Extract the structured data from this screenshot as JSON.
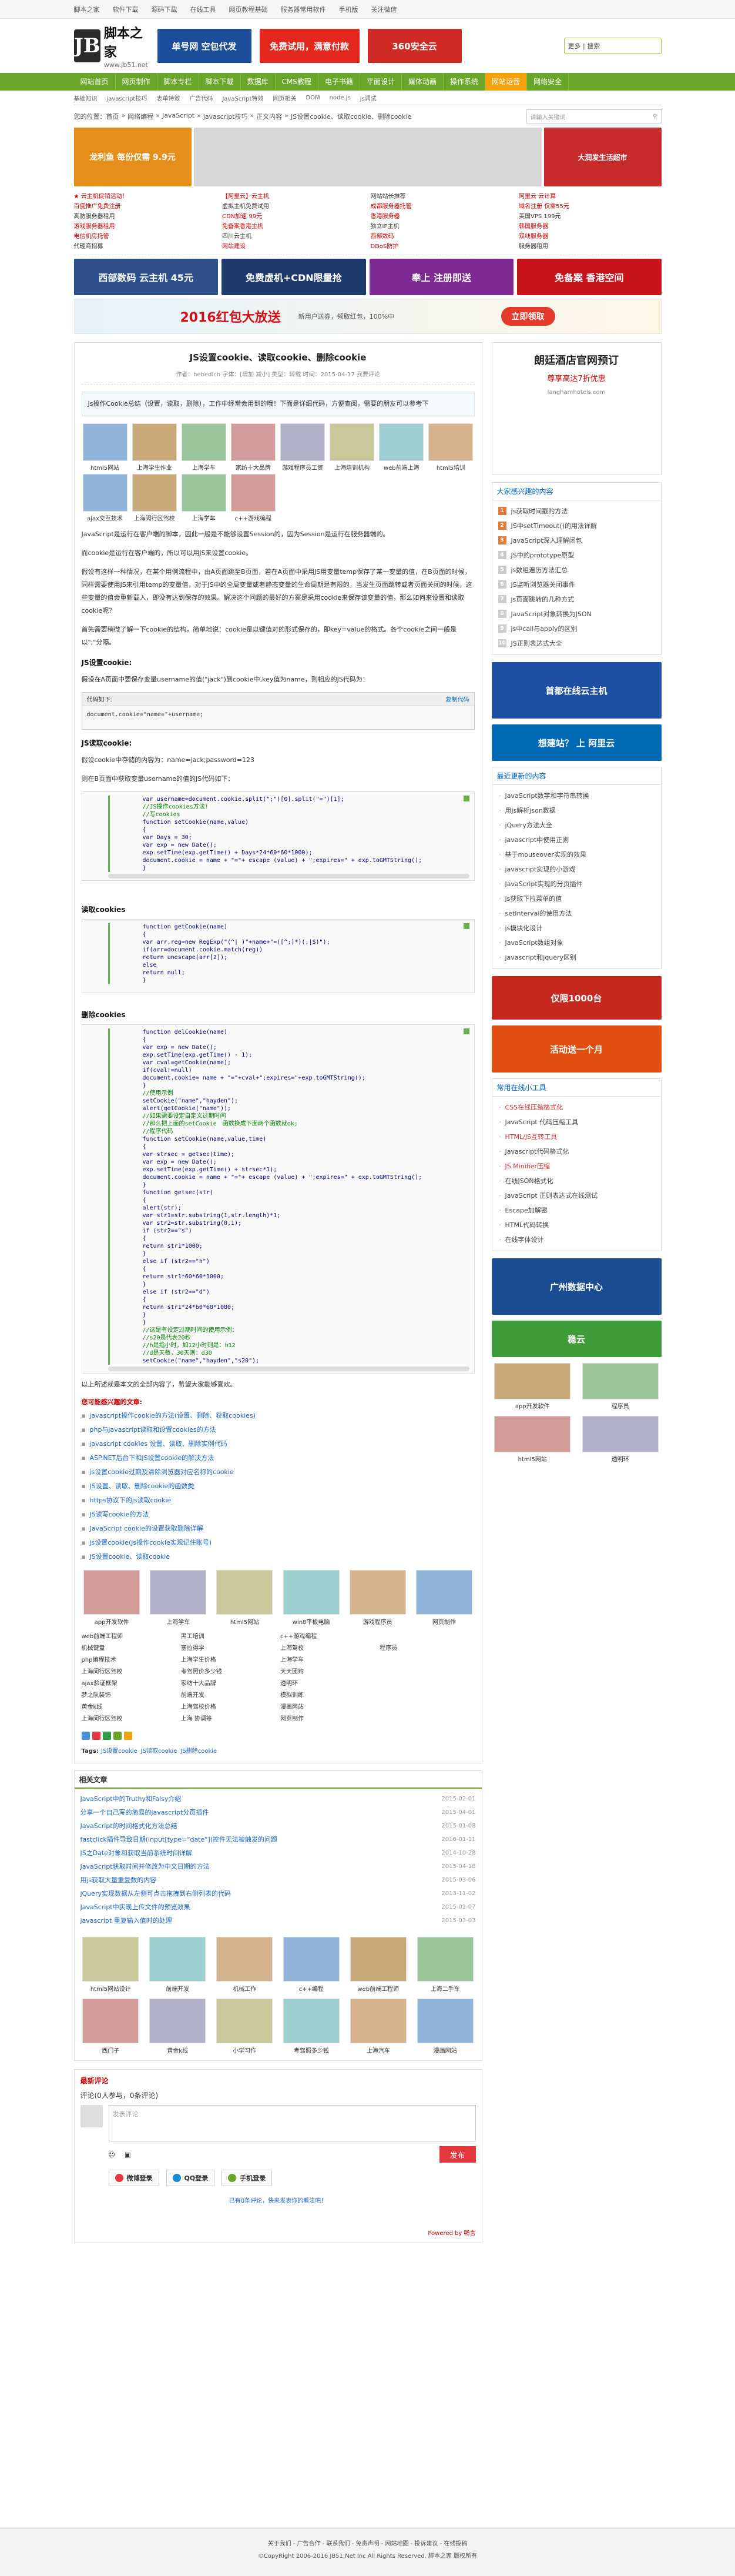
{
  "topbar": {
    "items": [
      "脚本之家",
      "软件下载",
      "源码下载",
      "在线工具",
      "网页教程基础",
      "服务器常用软件",
      "手机版",
      "关注微信"
    ]
  },
  "header": {
    "logo_mark": "JB",
    "logo_name": "脚本之家",
    "logo_url": "www.jb51.net",
    "banners": [
      {
        "text": "单号网 空包代发",
        "color": "#1c4e9a"
      },
      {
        "text": "免费试用，满意付款",
        "color": "#e3271d"
      },
      {
        "text": "360安全云",
        "color": "#cf2a26"
      }
    ],
    "search_lines": [
      "更多 | 搜索"
    ]
  },
  "nav": {
    "row1": [
      "网站首页",
      "网页制作",
      "脚本专栏",
      "脚本下载",
      "数据库",
      "CMS教程",
      "电子书籍",
      "平面设计",
      "媒体动画",
      "操作系统",
      "网站运营",
      "网络安全"
    ],
    "row2": [
      "平面设计",
      "媒体动画",
      "操作系统",
      "网站运营",
      "网络安全",
      "更多"
    ],
    "highlight": "网站运营"
  },
  "subnav": {
    "items": [
      "基础知识",
      "javascript技巧",
      "表单特效",
      "广告代码",
      "JavaScript特效",
      "网页相关",
      "DOM",
      "node.js",
      "js调试"
    ]
  },
  "breadcrumb": {
    "items": [
      "您的位置：首页",
      "网络编程",
      "JavaScript",
      "javascript技巧",
      "正文内容",
      "JS设置cookie、读取cookie、删除cookie"
    ],
    "search_placeholder": "请输入关键词"
  },
  "ads": {
    "main_band": [
      {
        "label": "龙利鱼 每份仅需 9.9元",
        "color": "#e58e1a"
      },
      {
        "label": "",
        "color": "#d7d7d7"
      },
      {
        "label": "大润发生活超市",
        "color": "#c72b2b"
      }
    ],
    "links": [
      "★ 云主机促销活动！",
      "【阿里云】云主机",
      "网站站长推荐",
      "阿里云 云计算",
      "百度推广免费注册",
      "虚拟主机免费试用",
      "成都服务器托管",
      "域名注册 仅需55元",
      "高防服务器租用",
      "CDN加速 99元",
      "香港服务器",
      "美国VPS 199元",
      "游戏服务器租用",
      "免备案香港主机",
      "独立IP主机",
      "韩国服务器",
      "电信机房托管",
      "四川云主机",
      "西部数码",
      "双线服务器",
      "代理商招募",
      "网站建设",
      "DDoS防护",
      "服务器租用"
    ],
    "row": [
      {
        "text": "西部数码 云主机 45元",
        "color": "#2d4f8c"
      },
      {
        "text": "免费虚机+CDN限量抢",
        "color": "#1e3a6d"
      },
      {
        "text": "奉上 注册即送",
        "color": "#7d2a94"
      },
      {
        "text": "免备案 香港空间",
        "color": "#c9141b"
      }
    ],
    "wide": "2016红包大放送",
    "wide_sub": "新用户送券，领取红包，100%中",
    "wide_btn": "立即领取"
  },
  "article": {
    "title": "JS设置cookie、读取cookie、删除cookie",
    "meta": "作者：hebedich 字体：[增加 减小] 类型：转载 时间：2015-04-17 我要评论",
    "summary": "Js操作Cookie总结（设置，读取，删除），工作中经常会用到的哦！下面是详细代码，方便查阅，需要的朋友可以参考下",
    "thumbs": [
      "html5网站",
      "上海学生作业",
      "上海学车",
      "家纺十大品牌",
      "游戏程序员工资",
      "上海培训机构",
      "web前端上海",
      "html5培训",
      "ajax交互技术",
      "上海闵行区驾校",
      "上海学车",
      "c++游戏编程"
    ],
    "p1": "JavaScript是运行在客户端的脚本，因此一般是不能够设置Session的，因为Session是运行在服务器端的。",
    "p2": "而cookie是运行在客户端的，所以可以用JS来设置cookie。",
    "p3": "假设有这样一种情况，在某个用例流程中，由A页面跳至B页面，若在A页面中采用JS用变量temp保存了某一变量的值，在B页面的时候，同样需要使用JS来引用temp的变量值，对于JS中的全局变量或者静态变量的生命周期是有限的，当发生页面跳转或者页面关闭的时候，这些变量的值会重新载入，即没有达到保存的效果。解决这个问题的最好的方案是采用cookie来保存该变量的值，那么如何来设置和读取cookie呢？",
    "p4": "首先需要稍微了解一下cookie的结构，简单地说：cookie是以键值对的形式保存的，即key=value的格式。各个cookie之间一般是以\";\"分隔。",
    "h_set": "JS设置cookie:",
    "p5": "假设在A页面中要保存变量username的值(\"jack\")到cookie中,key值为name，则相应的JS代码为：",
    "code_label": "代码如下:",
    "code_copy": "复制代码",
    "code_line": "document.cookie=\"name=\"+username;",
    "h_read": "JS读取cookie:",
    "p6": "假设cookie中存储的内容为：name=jack;password=123",
    "p7": "则在B页面中获取变量username的值的JS代码如下：",
    "h_read2": "读取cookies",
    "h_del": "删除cookies",
    "tip": "以上所述就是本文的全部内容了，希望大家能够喜欢。"
  },
  "code1": [
    "var username=document.cookie.split(\";\")[0].split(\"=\")[1];",
    "//JS操作cookies方法!",
    "//写cookies",
    "function setCookie(name,value)",
    "{",
    "var Days = 30;",
    "var exp = new Date();",
    "exp.setTime(exp.getTime() + Days*24*60*60*1000);",
    "document.cookie = name + \"=\"+ escape (value) + \";expires=\" + exp.toGMTString();",
    "}"
  ],
  "code2": [
    "function getCookie(name)",
    "{",
    "var arr,reg=new RegExp(\"(^| )\"+name+\"=([^;]*)(;|$)\");",
    "if(arr=document.cookie.match(reg))",
    "return unescape(arr[2]);",
    "else",
    "return null;",
    "}"
  ],
  "code3": [
    "function delCookie(name)",
    "{",
    "var exp = new Date();",
    "exp.setTime(exp.getTime() - 1);",
    "var cval=getCookie(name);",
    "if(cval!=null)",
    "document.cookie= name + \"=\"+cval+\";expires=\"+exp.toGMTString();",
    "}",
    "//使用示例",
    "setCookie(\"name\",\"hayden\");",
    "alert(getCookie(\"name\"));",
    "//如果需要设定自定义过期时间",
    "//那么把上面的setCookie　函数换成下面两个函数就ok;",
    "//程序代码",
    "function setCookie(name,value,time)",
    "{",
    "var strsec = getsec(time);",
    "var exp = new Date();",
    "exp.setTime(exp.getTime() + strsec*1);",
    "document.cookie = name + \"=\"+ escape (value) + \";expires=\" + exp.toGMTString();",
    "}",
    "function getsec(str)",
    "{",
    "alert(str);",
    "var str1=str.substring(1,str.length)*1;",
    "var str2=str.substring(0,1);",
    "if (str2==\"s\")",
    "{",
    "return str1*1000;",
    "}",
    "else if (str2==\"h\")",
    "{",
    "return str1*60*60*1000;",
    "}",
    "else if (str2==\"d\")",
    "{",
    "return str1*24*60*60*1000;",
    "}",
    "}",
    "//这是有设定过期时间的使用示例：",
    "//s20是代表20秒",
    "//h是指小时，如12小时则是：h12",
    "//d是天数，30天则：d30",
    "setCookie(\"name\",\"hayden\",\"s20\");"
  ],
  "related": {
    "heading": "您可能感兴趣的文章:",
    "items": [
      "javascript操作cookie的方法(设置、删除、获取cookies)",
      "php与javascript读取和设置cookies的方法",
      "javascript cookies 设置、读取、删除实例代码",
      "ASP.NET后台下和JS设置cookie的解决方法",
      "js设置cookie过期及清除浏览器对应名称的cookie",
      "JS设置、读取、删除cookie的函数类",
      "https协议下的js读取cookie",
      "JS读写cookie的方法",
      "JavaScript cookie的设置获取删除详解",
      "js设置cookie(js操作cookie实现记住账号)",
      "JS设置cookie、读取cookie"
    ],
    "thumbs": [
      "app开发软件",
      "上海学车",
      "html5网站",
      "win8平板电脑",
      "游戏程序员",
      "网页制作"
    ],
    "tlinks": [
      "web前端工程师",
      "黑工培训",
      "c++游戏编程",
      "",
      "机械键盘",
      "塞拉得学",
      "上海驾校",
      "程序员",
      "php编程技术",
      "上海学生价格",
      "上海学车",
      "",
      "上海闵行区驾校",
      "考驾照价多少钱",
      "天天团购",
      "",
      "ajax验证框架",
      "家纺十大品牌",
      "透明环",
      "",
      "梦之队装饰",
      "前端开发",
      "模拟训练",
      "",
      "黄金k线",
      "上海驾校价格",
      "漫画网站",
      "",
      "上海闵行区驾校",
      "上海 协调等",
      "网页制作",
      ""
    ],
    "tags_label": "Tags:",
    "tags": [
      "JS设置cookie",
      "JS读取cookie",
      "JS删除cookie"
    ]
  },
  "xg": {
    "title": "相关文章",
    "items": [
      {
        "t": "JavaScript中的Truthy和Falsy介绍",
        "d": "2015-02-01"
      },
      {
        "t": "分享一个自己写的简易的javascript分页插件",
        "d": "2015-04-01"
      },
      {
        "t": "JavaScript的时间格式化方法总结",
        "d": "2015-01-08"
      },
      {
        "t": "fastclick插件导致日期(input[type=\"date\"])控件无法被触发的问题",
        "d": "2016-01-11"
      },
      {
        "t": "JS之Date对象和获取当前系统时间详解",
        "d": "2014-10-28"
      },
      {
        "t": "JavaScript获取时间并修改为中文日期的方法",
        "d": "2015-04-18"
      },
      {
        "t": "用js获取大量重复数的内容",
        "d": "2015-03-06"
      },
      {
        "t": "jQuery实现数据从左侧可点击拖拽到右侧列表的代码",
        "d": "2013-11-02"
      },
      {
        "t": "JavaScript中实现上传文件的预览效果",
        "d": "2015-01-07"
      },
      {
        "t": "javascript 重复输入值时的处理",
        "d": "2015-03-03"
      }
    ],
    "thumbs": [
      "html5网站设计",
      "前端开发",
      "机械工作",
      "c++编程",
      "web前端工程师",
      "上海二手车",
      "西门子",
      "黄金k线",
      "小学习作",
      "考驾照多少钱",
      "上海汽车",
      "漫画网站"
    ]
  },
  "comment": {
    "title": "最新评论",
    "count_label": "评论(0人参与，0条评论)",
    "placeholder": "发表评论",
    "submit": "发布",
    "logins": [
      "微博登录",
      "QQ登录",
      "手机登录"
    ],
    "link": "已有0条评论，快来发表你的看法吧！",
    "powered": "Powered by 畅言"
  },
  "right": {
    "ad_title": "朗廷酒店官网预订",
    "ad_sub": "尊享高达7折优惠",
    "ad_small": "langhamhotels.com",
    "ad_btn": "",
    "fav_title": "大家感兴趣的内容",
    "fav": [
      "js获取时间戳的方法",
      "JS中setTimeout()的用法详解",
      "JavaScript深入理解闭包",
      "JS中的prototype原型",
      "js数组遍历方法汇总",
      "JS监听浏览器关闭事件",
      "js页面跳转的几种方式",
      "JavaScript对象转换为JSON",
      "js中call与apply的区别",
      "JS正则表达式大全"
    ],
    "new_title": "最近更新的内容",
    "news": [
      "JavaScript数字和字符串转换",
      "用js解析json数据",
      "jQuery方法大全",
      "javascript中使用正则",
      "基于mouseover实现的效果",
      "javascript实现的小游戏",
      "JavaScript实现的分页插件",
      "js获取下拉菜单的值",
      "setInterval的使用方法",
      "js模块化设计",
      "JavaScript数组对象",
      "javascript和jquery区别"
    ],
    "tools_title": "常用在线小工具",
    "tools": [
      "CSS在线压缩格式化",
      "JavaScript 代码压缩工具",
      "HTML/JS互转工具",
      "Javascript代码格式化",
      "JS Minifier压缩",
      "在线JSON格式化",
      "JavaScript 正则表达式在线测试",
      "Escape加解密",
      "HTML代码转换",
      "在线字体设计"
    ],
    "ads": [
      {
        "text": "首都在线云主机",
        "color": "#1e4fa3",
        "h": 96
      },
      {
        "text": "想建站？ 上 阿里云",
        "color": "#0069b6",
        "h": 62
      },
      {
        "text": "仅限1000台",
        "color": "#c7281f",
        "h": 74
      },
      {
        "text": "活动送一个月",
        "color": "#e24d12",
        "h": 80
      },
      {
        "text": "广州数据中心",
        "color": "#1b4c92",
        "h": 96
      },
      {
        "text": "稳云",
        "color": "#3d9b3a",
        "h": 62
      }
    ],
    "rthumbs": [
      "app开发软件",
      "程序员",
      "html5网站",
      "透明环"
    ]
  },
  "footer": {
    "line1": "关于我们 - 广告合作 - 联系我们 - 免责声明 - 网站地图 - 投诉建议 - 在线投稿",
    "line2": "©CopyRight 2006-2016 JB51.Net Inc All Rights Reserved. 脚本之家 版权所有"
  }
}
